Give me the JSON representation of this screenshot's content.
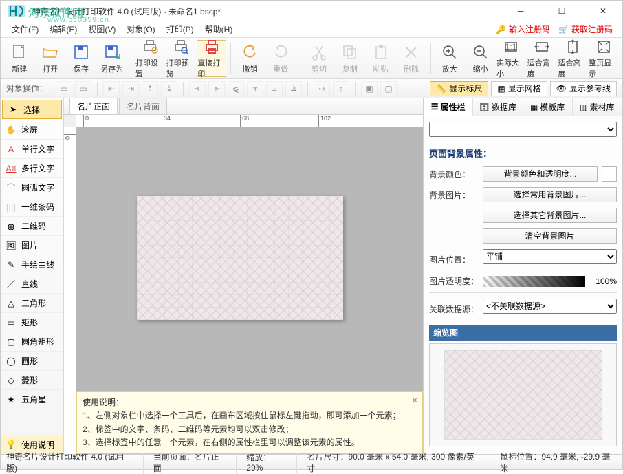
{
  "title": "神奇名片设计打印软件 4.0 (试用版) - 未命名1.bscp*",
  "watermark": "河东软件园",
  "watermark_url": "www.pc0359.cn",
  "menu": [
    "文件(F)",
    "编辑(E)",
    "视图(V)",
    "对象(O)",
    "打印(P)",
    "帮助(H)"
  ],
  "reg": {
    "enter": "输入注册码",
    "get": "获取注册码"
  },
  "toolbar": [
    {
      "id": "new",
      "label": "新建"
    },
    {
      "id": "open",
      "label": "打开"
    },
    {
      "id": "save",
      "label": "保存"
    },
    {
      "id": "saveas",
      "label": "另存为"
    },
    {
      "id": "printset",
      "label": "打印设置"
    },
    {
      "id": "printprev",
      "label": "打印预览"
    },
    {
      "id": "printnow",
      "label": "直接打印"
    },
    {
      "id": "undo",
      "label": "撤销"
    },
    {
      "id": "redo",
      "label": "重做"
    },
    {
      "id": "cut",
      "label": "剪切"
    },
    {
      "id": "copy",
      "label": "复制"
    },
    {
      "id": "paste",
      "label": "粘贴"
    },
    {
      "id": "delete",
      "label": "删除"
    },
    {
      "id": "zoomin",
      "label": "放大"
    },
    {
      "id": "zoomout",
      "label": "缩小"
    },
    {
      "id": "actual",
      "label": "实际大小"
    },
    {
      "id": "fitw",
      "label": "适合宽度"
    },
    {
      "id": "fith",
      "label": "适合高度"
    },
    {
      "id": "fitpage",
      "label": "整页显示"
    }
  ],
  "objectbar_label": "对象操作：",
  "viewtoggles": {
    "ruler": "显示标尺",
    "grid": "显示网格",
    "guides": "显示参考线"
  },
  "tools": [
    {
      "id": "select",
      "label": "选择",
      "active": true
    },
    {
      "id": "pan",
      "label": "滚屏"
    },
    {
      "id": "text1",
      "label": "单行文字"
    },
    {
      "id": "textm",
      "label": "多行文字"
    },
    {
      "id": "arctext",
      "label": "圆弧文字"
    },
    {
      "id": "barcode",
      "label": "一维条码"
    },
    {
      "id": "qr",
      "label": "二维码"
    },
    {
      "id": "image",
      "label": "图片"
    },
    {
      "id": "freehand",
      "label": "手绘曲线"
    },
    {
      "id": "line",
      "label": "直线"
    },
    {
      "id": "triangle",
      "label": "三角形"
    },
    {
      "id": "rect",
      "label": "矩形"
    },
    {
      "id": "roundrect",
      "label": "圆角矩形"
    },
    {
      "id": "ellipse",
      "label": "圆形"
    },
    {
      "id": "diamond",
      "label": "菱形"
    },
    {
      "id": "star",
      "label": "五角星"
    }
  ],
  "help_tool": "使用说明",
  "canvas_tabs": [
    "名片正面",
    "名片背面"
  ],
  "ruler_ticks": [
    0,
    34,
    68,
    102
  ],
  "hint": {
    "title": "使用说明：",
    "lines": [
      "1、左侧对象栏中选择一个工具后，在画布区域按住鼠标左键拖动，即可添加一个元素；",
      "2、标签中的文字、条码、二维码等元素均可以双击修改；",
      "3、选择标签中的任意一个元素，在右侧的属性栏里可以调整该元素的属性。"
    ]
  },
  "prop_tabs": [
    "属性栏",
    "数据库",
    "模板库",
    "素材库"
  ],
  "prop": {
    "section": "页面背景属性：",
    "bgcolor_label": "背景颜色：",
    "bgcolor_btn": "背景颜色和透明度...",
    "bgimg_label": "背景图片：",
    "bgimg_common": "选择常用背景图片...",
    "bgimg_other": "选择其它背景图片...",
    "bgimg_clear": "清空背景图片",
    "imgpos_label": "图片位置：",
    "imgpos_value": "平铺",
    "opacity_label": "图片透明度：",
    "opacity_value": "100%",
    "datasrc_label": "关联数据源：",
    "datasrc_value": "<不关联数据源>",
    "thumb": "缩览图"
  },
  "status": {
    "app": "神奇名片设计打印软件 4.0 (试用版)",
    "page": "当前页面：名片正面",
    "zoom": "缩放：29%",
    "size": "名片尺寸：90.0 毫米 x 54.0 毫米, 300 像素/英寸",
    "mouse": "鼠标位置：94.9 毫米, -29.9 毫米"
  }
}
